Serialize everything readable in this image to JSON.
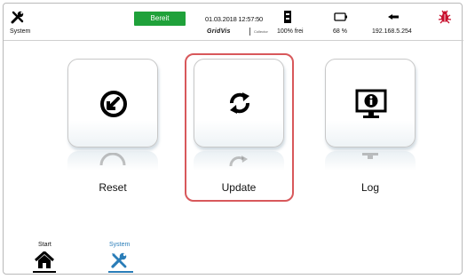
{
  "header": {
    "section_label": "System",
    "status": "Bereit",
    "datetime": "01.03.2018 12:57:50",
    "brand": "GridVis",
    "brand_sub": "Collector",
    "storage": "100% frei",
    "battery": "68 %",
    "ip": "192.168.5.254"
  },
  "tiles": [
    {
      "label": "Reset",
      "icon": "reset-icon"
    },
    {
      "label": "Update",
      "icon": "update-icon"
    },
    {
      "label": "Log",
      "icon": "info-monitor-icon"
    }
  ],
  "nav": {
    "items": [
      {
        "label": "Start",
        "icon": "home-icon"
      },
      {
        "label": "System",
        "icon": "tools-icon"
      }
    ]
  },
  "colors": {
    "status_green": "#1fa13a",
    "selection_red": "#d8585b",
    "active_blue": "#2a7db8",
    "alert_red": "#c8102e"
  }
}
